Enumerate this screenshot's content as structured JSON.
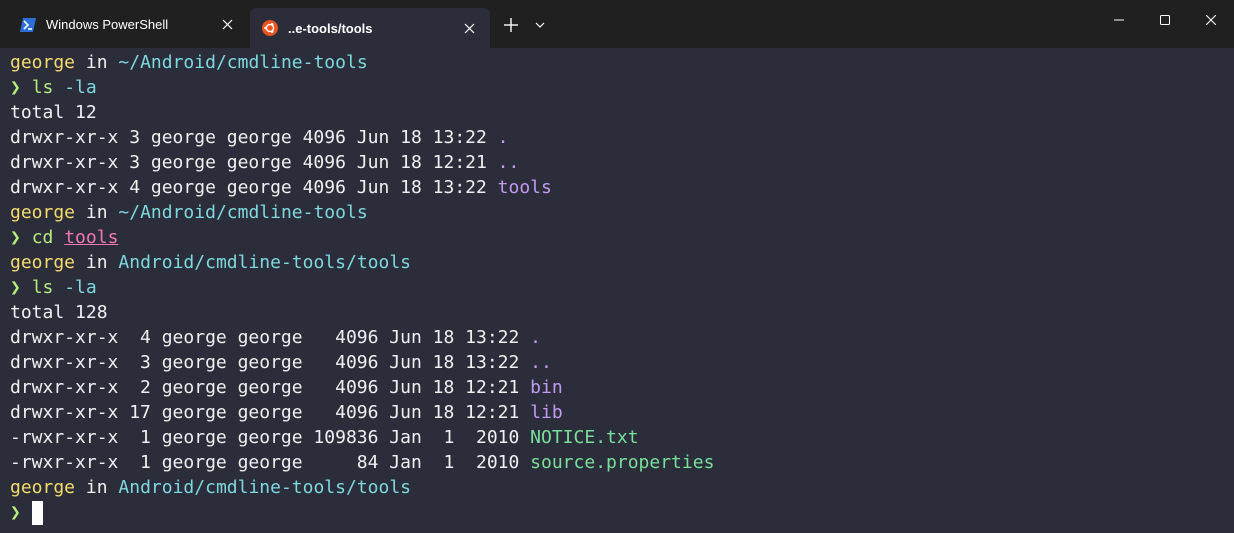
{
  "window": {
    "tabs": [
      {
        "label": "Windows PowerShell",
        "icon": "powershell-icon",
        "active": false
      },
      {
        "label": "..e-tools/tools",
        "icon": "ubuntu-icon",
        "active": true
      }
    ],
    "new_tab_label": "+",
    "colors": {
      "titlebar": "#202020",
      "terminal_bg": "#2b2d3a",
      "user": "#f5dc6a",
      "path": "#7ed9df",
      "prompt": "#b6ec7d",
      "directory": "#c39af0",
      "file": "#78e09a",
      "link": "#f278b8"
    }
  },
  "terminal": {
    "user": "george",
    "in_word": "in",
    "prompt_symbol": "❯",
    "path_home": "~/Android/cmdline-tools",
    "path_tools": "Android/cmdline-tools/tools",
    "cmd_ls": "ls",
    "arg_la": "-la",
    "cmd_cd": "cd",
    "arg_tools": "tools",
    "total_1": "total 12",
    "listing_1": [
      {
        "meta": "drwxr-xr-x 3 george george 4096 Jun 18 13:22 ",
        "name": "."
      },
      {
        "meta": "drwxr-xr-x 3 george george 4096 Jun 18 12:21 ",
        "name": ".."
      },
      {
        "meta": "drwxr-xr-x 4 george george 4096 Jun 18 13:22 ",
        "name": "tools"
      }
    ],
    "total_2": "total 128",
    "listing_2": [
      {
        "meta": "drwxr-xr-x  4 george george   4096 Jun 18 13:22 ",
        "name": ".",
        "kind": "dir"
      },
      {
        "meta": "drwxr-xr-x  3 george george   4096 Jun 18 13:22 ",
        "name": "..",
        "kind": "dir"
      },
      {
        "meta": "drwxr-xr-x  2 george george   4096 Jun 18 12:21 ",
        "name": "bin",
        "kind": "dir"
      },
      {
        "meta": "drwxr-xr-x 17 george george   4096 Jun 18 12:21 ",
        "name": "lib",
        "kind": "dir"
      },
      {
        "meta": "-rwxr-xr-x  1 george george 109836 Jan  1  2010 ",
        "name": "NOTICE.txt",
        "kind": "file"
      },
      {
        "meta": "-rwxr-xr-x  1 george george     84 Jan  1  2010 ",
        "name": "source.properties",
        "kind": "file"
      }
    ]
  }
}
